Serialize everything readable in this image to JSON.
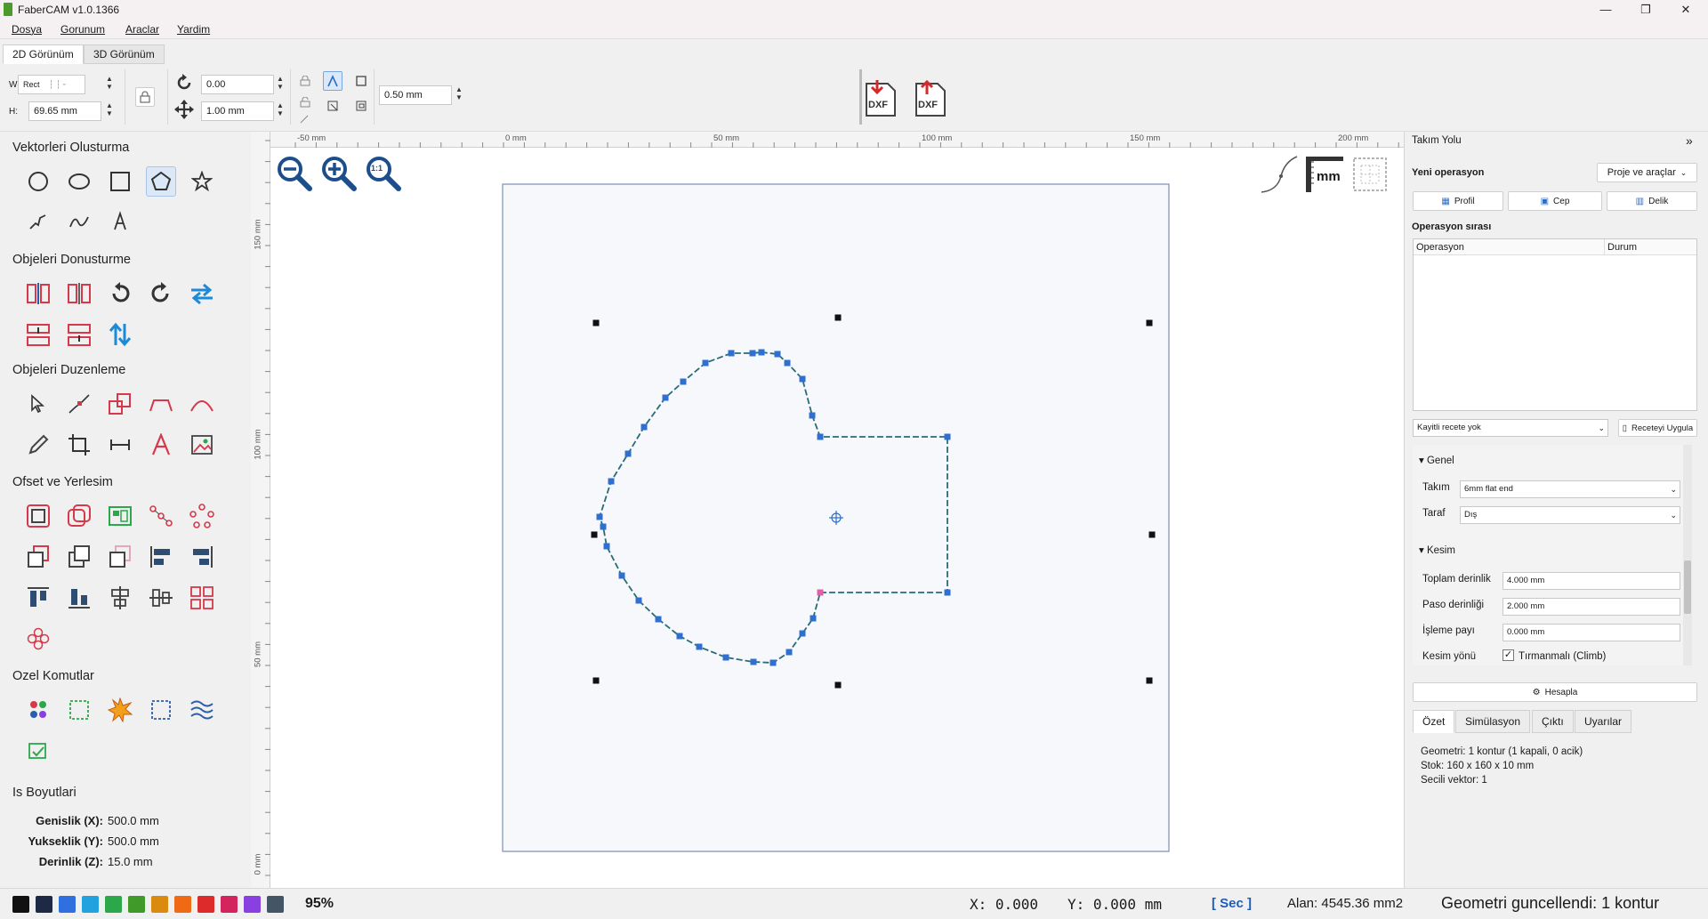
{
  "window": {
    "title": "FaberCAM v1.0.1366",
    "minimize": "—",
    "maximize": "❐",
    "close": "✕"
  },
  "menu": [
    "Dosya",
    "Gorunum",
    "Araclar",
    "Yardim"
  ],
  "view_tabs": [
    "2D Görünüm",
    "3D Görünüm"
  ],
  "toolbar": {
    "w_label": "W",
    "shape_value": "Rect",
    "h_label": "H:",
    "h_value": "69.65 mm",
    "rotation_value": "0.00",
    "move_value": "1.00 mm",
    "offset_value": "0.50 mm",
    "dxf_import": "DXF",
    "dxf_export": "DXF"
  },
  "left_panel": {
    "sections": {
      "vektorler": "Vektorleri Olusturma",
      "donusturme": "Objeleri Donusturme",
      "duzenleme": "Objeleri Duzenleme",
      "ofset": "Ofset ve Yerlesim",
      "ozel": "Ozel Komutlar",
      "is": "Is Boyutlari"
    },
    "dimensions": [
      {
        "label": "Genislik  (X):",
        "value": "500.0 mm"
      },
      {
        "label": "Yukseklik  (Y):",
        "value": "500.0 mm"
      },
      {
        "label": "Derinlik  (Z):",
        "value": "15.0 mm"
      }
    ]
  },
  "ruler": {
    "top": [
      "-50 mm",
      "0 mm",
      "50 mm",
      "100 mm",
      "150 mm",
      "200 mm"
    ],
    "left": [
      "150 mm",
      "100 mm",
      "50 mm",
      "0 mm"
    ]
  },
  "canvas": {
    "unit_badge": "mm",
    "zoom_actual": "1:1"
  },
  "right_panel": {
    "title": "Takım Yolu",
    "collapse": "»",
    "new_op_label": "Yeni operasyon",
    "project_tools": "Proje ve araçlar",
    "op_buttons": [
      "Profil",
      "Cep",
      "Delik"
    ],
    "op_order_label": "Operasyon sırası",
    "table_headers": [
      "Operasyon",
      "Durum"
    ],
    "recipe_select": "Kayitli recete yok",
    "recipe_apply": "Receteyi Uygula",
    "group_general": "Genel",
    "tool_label": "Takım",
    "tool_value": "6mm flat end",
    "side_label": "Taraf",
    "side_value": "Dış",
    "group_cut": "Kesim",
    "total_depth_label": "Toplam derinlik",
    "total_depth_value": "4.000 mm",
    "pass_depth_label": "Paso derinliği",
    "pass_depth_value": "2.000 mm",
    "allowance_label": "İşleme payı",
    "allowance_value": "0.000 mm",
    "cut_dir_label": "Kesim yönü",
    "cut_dir_value": "Tırmanmalı (Climb)",
    "compute": "Hesapla",
    "bottom_tabs": [
      "Özet",
      "Simülasyon",
      "Çıktı",
      "Uyarılar"
    ],
    "summary": [
      "Geometri: 1 kontur (1 kapali, 0 acik)",
      "Stok: 160 x 160 x 10 mm",
      "Secili vektor: 1"
    ]
  },
  "status": {
    "palette": [
      "#111111",
      "#1e2a44",
      "#2f6fe0",
      "#22a3e0",
      "#2aa84a",
      "#3f9a2a",
      "#d98a0f",
      "#ef6a12",
      "#dd2b2b",
      "#d3245e",
      "#8a3fe0",
      "#445566"
    ],
    "zoom": "95%",
    "x": "X: 0.000",
    "y": "Y: 0.000 mm",
    "mode": "[ Sec ]",
    "area": "Alan: 4545.36 mm2",
    "message": "Geometri guncellendi: 1 kontur"
  },
  "colors": {
    "accent": "#2b6cc4",
    "path": "#2a6b78",
    "node": "#2f6fd0",
    "start_node": "#e060a8"
  }
}
